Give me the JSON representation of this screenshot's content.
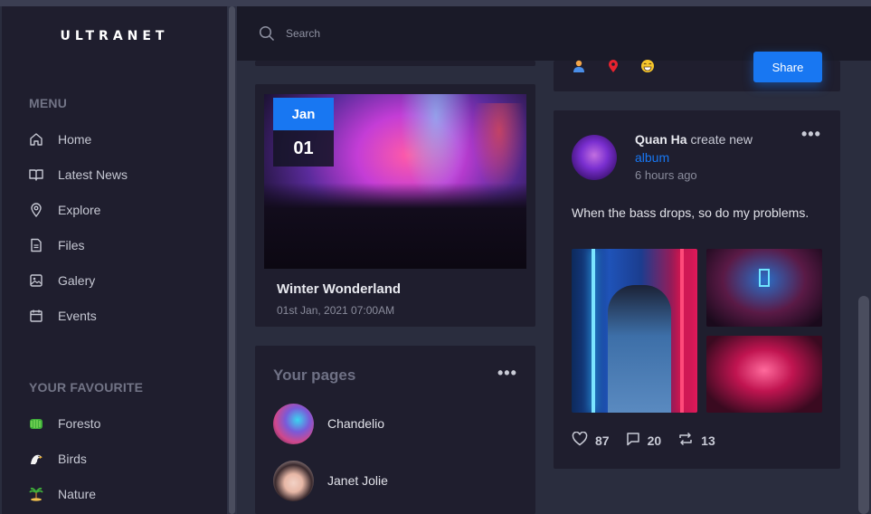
{
  "app": {
    "logo": "ULTRANET"
  },
  "search": {
    "placeholder": "Search",
    "value": ""
  },
  "sidebar": {
    "menu_title": "MENU",
    "menu": [
      {
        "label": "Home",
        "icon": "home-icon"
      },
      {
        "label": "Latest News",
        "icon": "book-icon"
      },
      {
        "label": "Explore",
        "icon": "location-pin-icon"
      },
      {
        "label": "Files",
        "icon": "file-icon"
      },
      {
        "label": "Galery",
        "icon": "image-icon"
      },
      {
        "label": "Events",
        "icon": "calendar-icon"
      }
    ],
    "fav_title": "YOUR FAVOURITE",
    "favourites": [
      {
        "label": "Foresto",
        "icon": "tree-emoji-icon"
      },
      {
        "label": "Birds",
        "icon": "eagle-emoji-icon"
      },
      {
        "label": "Nature",
        "icon": "palm-island-emoji-icon"
      }
    ]
  },
  "event": {
    "month": "Jan",
    "day": "01",
    "title": "Winter Wonderland",
    "datetime": "01st Jan, 2021 07:00AM"
  },
  "pages": {
    "title": "Your pages",
    "items": [
      {
        "name": "Chandelio"
      },
      {
        "name": "Janet Jolie"
      }
    ]
  },
  "share": {
    "button_label": "Share"
  },
  "post": {
    "author": "Quan Ha",
    "action": "create new",
    "link": "album",
    "time": "6 hours ago",
    "text": "When the bass drops, so do my problems.",
    "likes": "87",
    "comments": "20",
    "reposts": "13"
  },
  "colors": {
    "accent": "#1877f2",
    "sidebar_bg": "#1f1e2e",
    "page_bg": "#2a2d3e"
  }
}
